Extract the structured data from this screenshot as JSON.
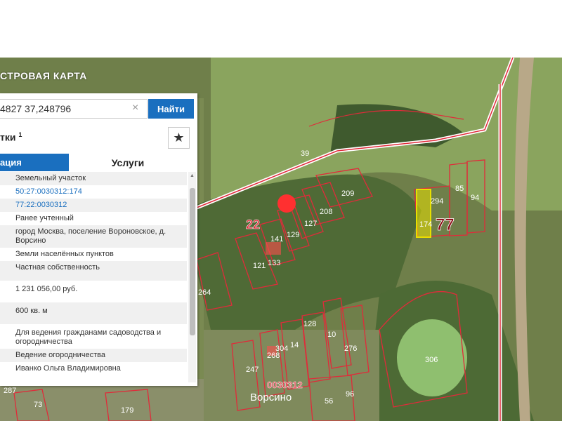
{
  "map": {
    "title": "СТРОВАЯ КАРТА",
    "labels": {
      "block_22": "22",
      "block_77": "77",
      "quarter": "0030312",
      "village": "Ворсино"
    },
    "parcels": [
      "39",
      "209",
      "208",
      "127",
      "129",
      "141",
      "133",
      "121",
      "264",
      "294",
      "85",
      "94",
      "174",
      "306",
      "247",
      "268",
      "304",
      "14",
      "128",
      "10",
      "276",
      "287",
      "73",
      "179",
      "56",
      "96"
    ]
  },
  "search": {
    "value": "4827 37,248796",
    "button_label": "Найти"
  },
  "panel": {
    "objects_title": "тки",
    "objects_sup": "1",
    "tabs": {
      "info": "ация",
      "services": "Услуги"
    },
    "rows": [
      "Земельный участок",
      "50:27:0030312:174",
      "77:22:0030312",
      "Ранее учтенный",
      "город Москва, поселение Вороновское, д. Ворсино",
      "Земли населённых пунктов",
      "Частная собственность",
      "1 231 056,00 руб.",
      "600 кв. м",
      "Для ведения гражданами садоводства и огородничества",
      "Ведение огородничества",
      "Иванко Ольга Владимировна"
    ]
  },
  "colors": {
    "accent": "#1a6fbf",
    "border": "#e02b3a"
  }
}
